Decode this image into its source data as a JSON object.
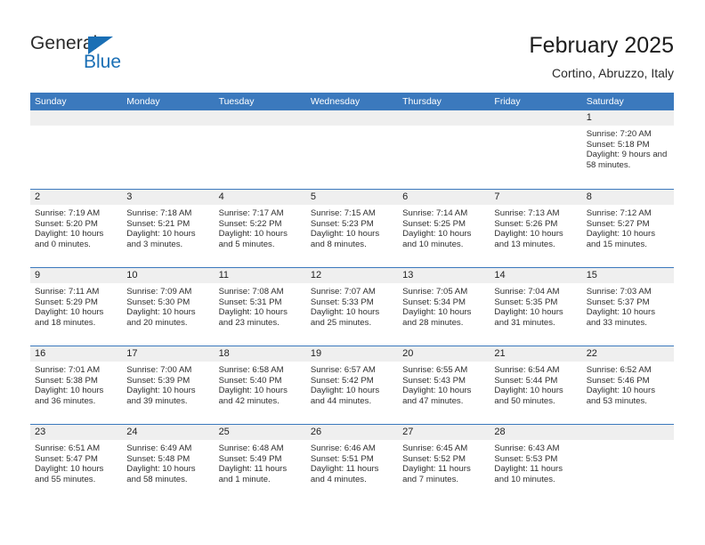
{
  "brand": {
    "word_one": "General",
    "word_two": "Blue",
    "accent_color": "#1a6fb5"
  },
  "header": {
    "title": "February 2025",
    "subtitle": "Cortino, Abruzzo, Italy"
  },
  "theme": {
    "header_blue": "#3b79bd",
    "daynum_band": "#efefef",
    "text": "#2f2f2f"
  },
  "weekday_headers": [
    "Sunday",
    "Monday",
    "Tuesday",
    "Wednesday",
    "Thursday",
    "Friday",
    "Saturday"
  ],
  "weeks": [
    [
      {
        "day": "",
        "sunrise": "",
        "sunset": "",
        "daylight": ""
      },
      {
        "day": "",
        "sunrise": "",
        "sunset": "",
        "daylight": ""
      },
      {
        "day": "",
        "sunrise": "",
        "sunset": "",
        "daylight": ""
      },
      {
        "day": "",
        "sunrise": "",
        "sunset": "",
        "daylight": ""
      },
      {
        "day": "",
        "sunrise": "",
        "sunset": "",
        "daylight": ""
      },
      {
        "day": "",
        "sunrise": "",
        "sunset": "",
        "daylight": ""
      },
      {
        "day": "1",
        "sunrise": "Sunrise: 7:20 AM",
        "sunset": "Sunset: 5:18 PM",
        "daylight": "Daylight: 9 hours and 58 minutes."
      }
    ],
    [
      {
        "day": "2",
        "sunrise": "Sunrise: 7:19 AM",
        "sunset": "Sunset: 5:20 PM",
        "daylight": "Daylight: 10 hours and 0 minutes."
      },
      {
        "day": "3",
        "sunrise": "Sunrise: 7:18 AM",
        "sunset": "Sunset: 5:21 PM",
        "daylight": "Daylight: 10 hours and 3 minutes."
      },
      {
        "day": "4",
        "sunrise": "Sunrise: 7:17 AM",
        "sunset": "Sunset: 5:22 PM",
        "daylight": "Daylight: 10 hours and 5 minutes."
      },
      {
        "day": "5",
        "sunrise": "Sunrise: 7:15 AM",
        "sunset": "Sunset: 5:23 PM",
        "daylight": "Daylight: 10 hours and 8 minutes."
      },
      {
        "day": "6",
        "sunrise": "Sunrise: 7:14 AM",
        "sunset": "Sunset: 5:25 PM",
        "daylight": "Daylight: 10 hours and 10 minutes."
      },
      {
        "day": "7",
        "sunrise": "Sunrise: 7:13 AM",
        "sunset": "Sunset: 5:26 PM",
        "daylight": "Daylight: 10 hours and 13 minutes."
      },
      {
        "day": "8",
        "sunrise": "Sunrise: 7:12 AM",
        "sunset": "Sunset: 5:27 PM",
        "daylight": "Daylight: 10 hours and 15 minutes."
      }
    ],
    [
      {
        "day": "9",
        "sunrise": "Sunrise: 7:11 AM",
        "sunset": "Sunset: 5:29 PM",
        "daylight": "Daylight: 10 hours and 18 minutes."
      },
      {
        "day": "10",
        "sunrise": "Sunrise: 7:09 AM",
        "sunset": "Sunset: 5:30 PM",
        "daylight": "Daylight: 10 hours and 20 minutes."
      },
      {
        "day": "11",
        "sunrise": "Sunrise: 7:08 AM",
        "sunset": "Sunset: 5:31 PM",
        "daylight": "Daylight: 10 hours and 23 minutes."
      },
      {
        "day": "12",
        "sunrise": "Sunrise: 7:07 AM",
        "sunset": "Sunset: 5:33 PM",
        "daylight": "Daylight: 10 hours and 25 minutes."
      },
      {
        "day": "13",
        "sunrise": "Sunrise: 7:05 AM",
        "sunset": "Sunset: 5:34 PM",
        "daylight": "Daylight: 10 hours and 28 minutes."
      },
      {
        "day": "14",
        "sunrise": "Sunrise: 7:04 AM",
        "sunset": "Sunset: 5:35 PM",
        "daylight": "Daylight: 10 hours and 31 minutes."
      },
      {
        "day": "15",
        "sunrise": "Sunrise: 7:03 AM",
        "sunset": "Sunset: 5:37 PM",
        "daylight": "Daylight: 10 hours and 33 minutes."
      }
    ],
    [
      {
        "day": "16",
        "sunrise": "Sunrise: 7:01 AM",
        "sunset": "Sunset: 5:38 PM",
        "daylight": "Daylight: 10 hours and 36 minutes."
      },
      {
        "day": "17",
        "sunrise": "Sunrise: 7:00 AM",
        "sunset": "Sunset: 5:39 PM",
        "daylight": "Daylight: 10 hours and 39 minutes."
      },
      {
        "day": "18",
        "sunrise": "Sunrise: 6:58 AM",
        "sunset": "Sunset: 5:40 PM",
        "daylight": "Daylight: 10 hours and 42 minutes."
      },
      {
        "day": "19",
        "sunrise": "Sunrise: 6:57 AM",
        "sunset": "Sunset: 5:42 PM",
        "daylight": "Daylight: 10 hours and 44 minutes."
      },
      {
        "day": "20",
        "sunrise": "Sunrise: 6:55 AM",
        "sunset": "Sunset: 5:43 PM",
        "daylight": "Daylight: 10 hours and 47 minutes."
      },
      {
        "day": "21",
        "sunrise": "Sunrise: 6:54 AM",
        "sunset": "Sunset: 5:44 PM",
        "daylight": "Daylight: 10 hours and 50 minutes."
      },
      {
        "day": "22",
        "sunrise": "Sunrise: 6:52 AM",
        "sunset": "Sunset: 5:46 PM",
        "daylight": "Daylight: 10 hours and 53 minutes."
      }
    ],
    [
      {
        "day": "23",
        "sunrise": "Sunrise: 6:51 AM",
        "sunset": "Sunset: 5:47 PM",
        "daylight": "Daylight: 10 hours and 55 minutes."
      },
      {
        "day": "24",
        "sunrise": "Sunrise: 6:49 AM",
        "sunset": "Sunset: 5:48 PM",
        "daylight": "Daylight: 10 hours and 58 minutes."
      },
      {
        "day": "25",
        "sunrise": "Sunrise: 6:48 AM",
        "sunset": "Sunset: 5:49 PM",
        "daylight": "Daylight: 11 hours and 1 minute."
      },
      {
        "day": "26",
        "sunrise": "Sunrise: 6:46 AM",
        "sunset": "Sunset: 5:51 PM",
        "daylight": "Daylight: 11 hours and 4 minutes."
      },
      {
        "day": "27",
        "sunrise": "Sunrise: 6:45 AM",
        "sunset": "Sunset: 5:52 PM",
        "daylight": "Daylight: 11 hours and 7 minutes."
      },
      {
        "day": "28",
        "sunrise": "Sunrise: 6:43 AM",
        "sunset": "Sunset: 5:53 PM",
        "daylight": "Daylight: 11 hours and 10 minutes."
      },
      {
        "day": "",
        "sunrise": "",
        "sunset": "",
        "daylight": ""
      }
    ]
  ]
}
